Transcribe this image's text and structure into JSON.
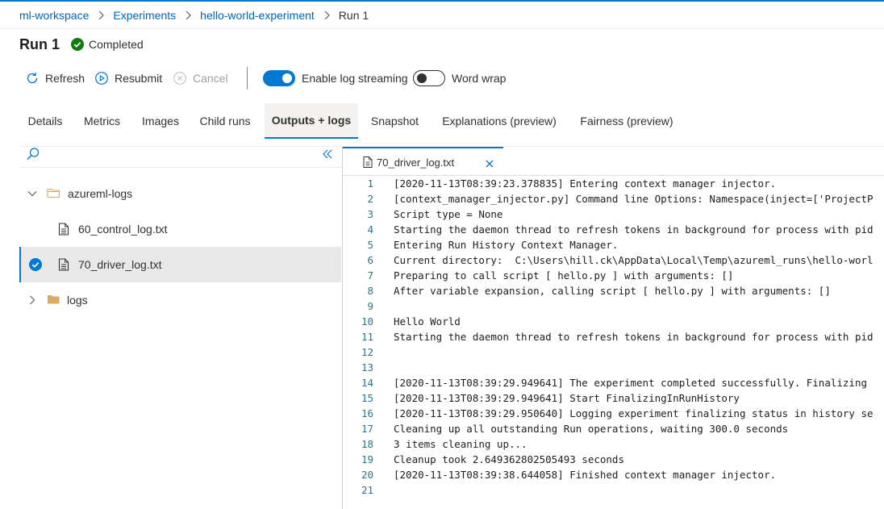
{
  "breadcrumb": {
    "items": [
      "ml-workspace",
      "Experiments",
      "hello-world-experiment"
    ],
    "current": "Run 1"
  },
  "header": {
    "title": "Run 1",
    "status": "Completed"
  },
  "toolbar": {
    "refresh": "Refresh",
    "resubmit": "Resubmit",
    "cancel": "Cancel",
    "log_streaming": "Enable log streaming",
    "log_streaming_on": true,
    "word_wrap": "Word wrap",
    "word_wrap_on": false
  },
  "tabs": [
    {
      "label": "Details"
    },
    {
      "label": "Metrics"
    },
    {
      "label": "Images"
    },
    {
      "label": "Child runs"
    },
    {
      "label": "Outputs + logs",
      "active": true
    },
    {
      "label": "Snapshot"
    },
    {
      "label": "Explanations (preview)"
    },
    {
      "label": "Fairness (preview)"
    }
  ],
  "file_tree": {
    "folder1": "azureml-logs",
    "file1": "60_control_log.txt",
    "file2": "70_driver_log.txt",
    "folder2": "logs"
  },
  "editor": {
    "open_tab": "70_driver_log.txt",
    "lines": [
      "[2020-11-13T08:39:23.378835] Entering context manager injector.",
      "[context_manager_injector.py] Command line Options: Namespace(inject=['ProjectP",
      "Script type = None",
      "Starting the daemon thread to refresh tokens in background for process with pid",
      "Entering Run History Context Manager.",
      "Current directory:  C:\\Users\\hill.ck\\AppData\\Local\\Temp\\azureml_runs\\hello-worl",
      "Preparing to call script [ hello.py ] with arguments: []",
      "After variable expansion, calling script [ hello.py ] with arguments: []",
      "",
      "Hello World",
      "Starting the daemon thread to refresh tokens in background for process with pid",
      "",
      "",
      "[2020-11-13T08:39:29.949641] The experiment completed successfully. Finalizing",
      "[2020-11-13T08:39:29.949641] Start FinalizingInRunHistory",
      "[2020-11-13T08:39:29.950640] Logging experiment finalizing status in history se",
      "Cleaning up all outstanding Run operations, waiting 300.0 seconds",
      "3 items cleaning up...",
      "Cleanup took 2.649362802505493 seconds",
      "[2020-11-13T08:39:38.644058] Finished context manager injector.",
      ""
    ]
  },
  "colors": {
    "accent": "#0078d4",
    "link": "#0067b8",
    "success": "#107c10",
    "line_number": "#237893"
  }
}
